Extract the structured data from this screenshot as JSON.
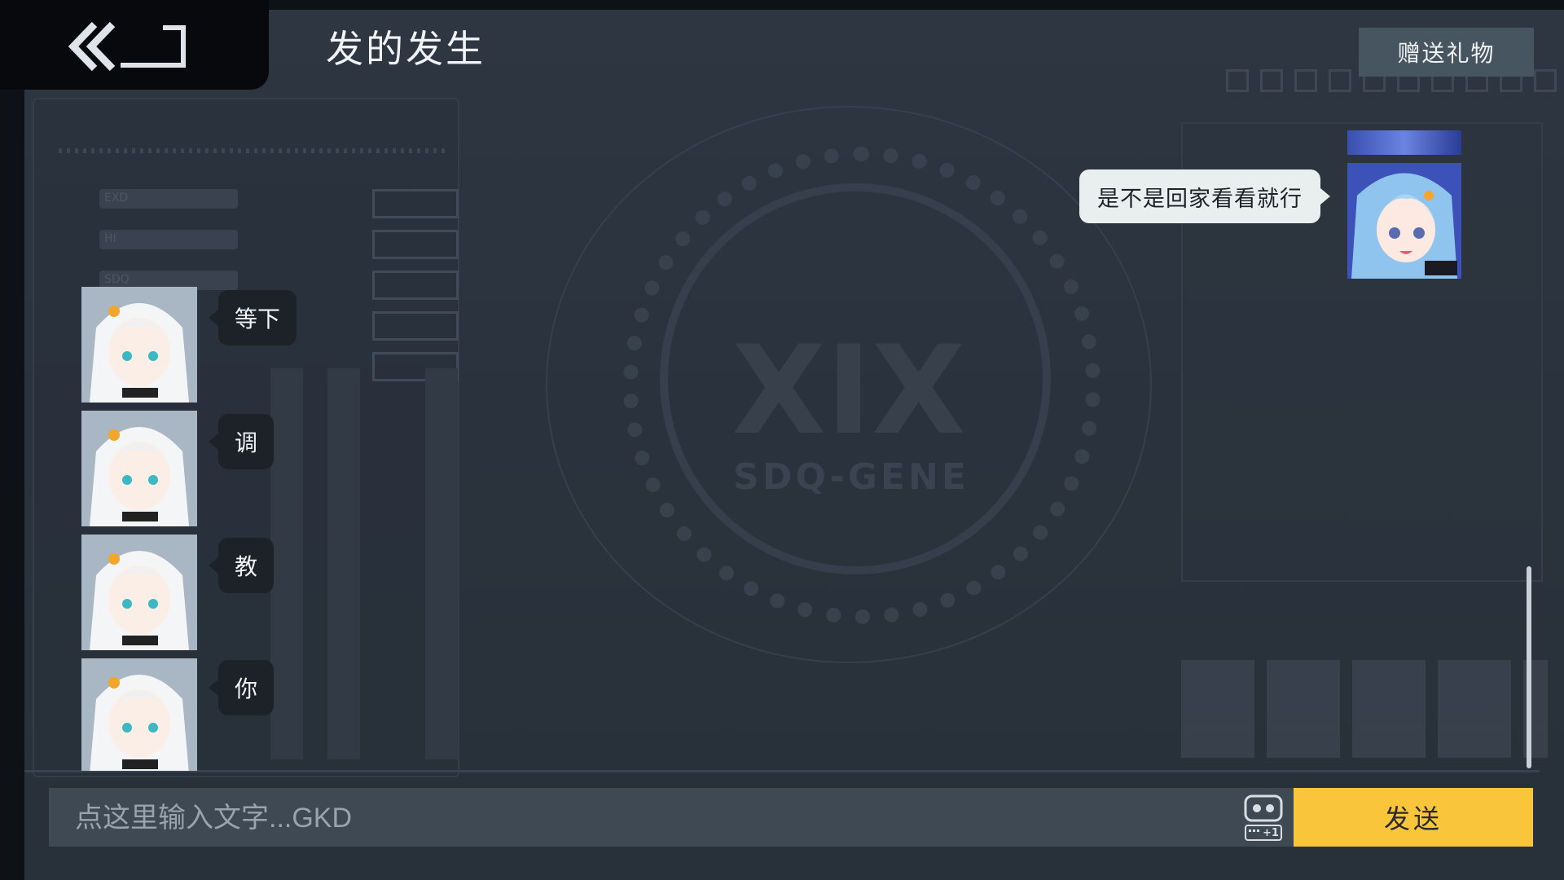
{
  "header": {
    "back_icon": "double-chevron-left-icon",
    "title": "发的发生",
    "gift_label": "赠送礼物"
  },
  "messages_left": [
    {
      "text": "等下",
      "avatar": "white-hair-girl-avatar"
    },
    {
      "text": "调",
      "avatar": "white-hair-girl-avatar"
    },
    {
      "text": "教",
      "avatar": "white-hair-girl-avatar"
    },
    {
      "text": "你",
      "avatar": "white-hair-girl-avatar"
    }
  ],
  "message_right": {
    "text": "是不是回家看看就行",
    "avatar": "blue-hair-girl-avatar"
  },
  "background": {
    "logo_text": "SDQ-GENE",
    "slot_labels": [
      "EXD",
      "HI",
      "SDQ"
    ]
  },
  "input": {
    "placeholder": "点这里输入文字...GKD",
    "value": "",
    "emoji_badge": "+1"
  },
  "send_label": "发送",
  "colors": {
    "send_button": "#f8c53b",
    "gift_button": "#46555f",
    "bubble_left": "#1d2228",
    "bubble_right": "#e8efee"
  }
}
